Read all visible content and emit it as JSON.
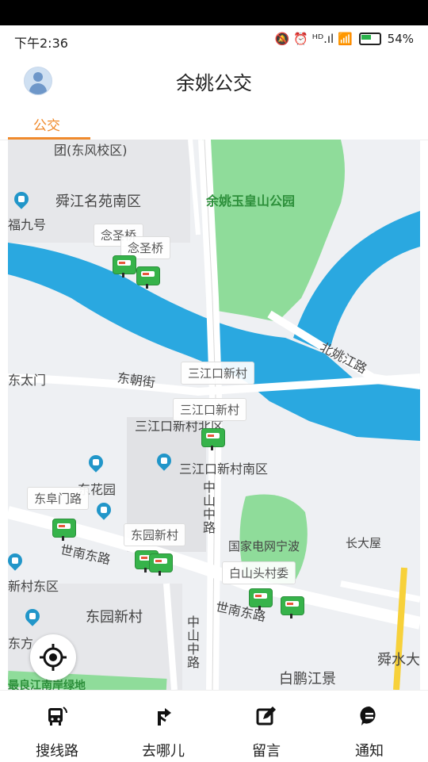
{
  "status": {
    "time": "下午2:36",
    "icons": "🔕 ⏰ ᴴᴰ.ıl 📶",
    "battery": "54%"
  },
  "header": {
    "title": "余姚公交"
  },
  "tabs": [
    {
      "label": "公交"
    }
  ],
  "map": {
    "labels": {
      "dongfeng": "团(东风校区)",
      "shunjiang": "舜江名苑南区",
      "fujiu": "福九号",
      "yuhuangshan": "余姚玉皇山公园",
      "beiyao": "北姚江路",
      "dongtaimen": "东太门",
      "dongchao": "东朝街",
      "sanjiangkou_n": "三江口新村北区",
      "sanjiangkou_s": "三江口新村南区",
      "donghuayuan": "东花园",
      "shinan1": "世南东路",
      "shinan2": "世南东路",
      "zhongshan1": "中山中路",
      "zhongshan2": "中山中路",
      "guojia": "国家电网宁波",
      "changdawu": "长大屋",
      "dongyuan": "东园新村",
      "xincun": "新村东区",
      "dongfang": "东方",
      "baipeng": "白鹏江景",
      "shunshui": "舜水大",
      "jiangnan": "最良江南岸绿地"
    },
    "tags": {
      "nianshengqiao_a": "念圣桥",
      "nianshengqiao_b": "念圣桥",
      "sjk1": "三江口新村",
      "sjk2": "三江口新村",
      "dongfumen": "东阜门路",
      "dongyuan2": "东园新村",
      "baishantou": "白山头村委"
    }
  },
  "bottom_nav": [
    {
      "label": "搜线路",
      "icon": "bus-icon"
    },
    {
      "label": "去哪儿",
      "icon": "route-icon"
    },
    {
      "label": "留言",
      "icon": "edit-icon"
    },
    {
      "label": "通知",
      "icon": "message-icon"
    }
  ]
}
